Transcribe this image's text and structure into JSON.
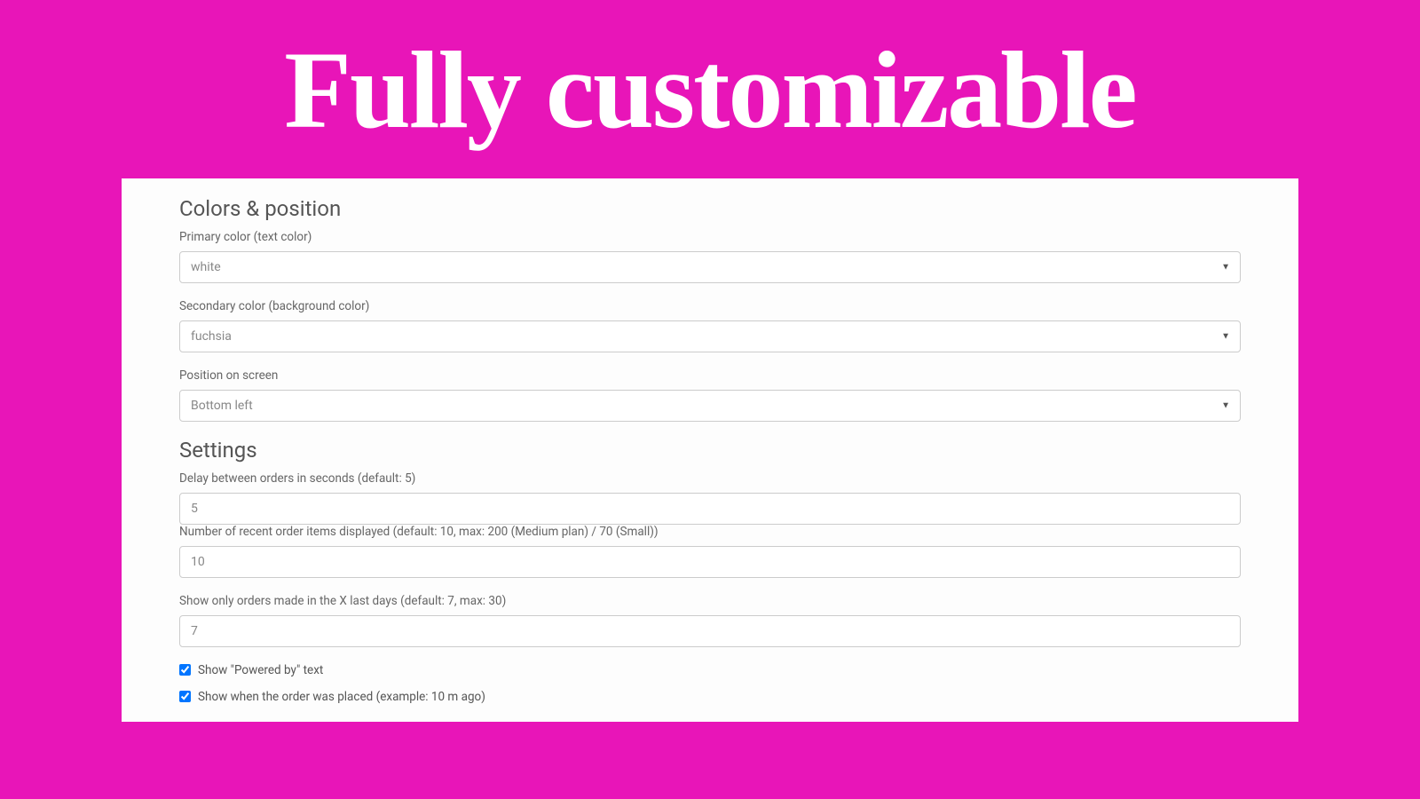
{
  "hero": {
    "title": "Fully customizable"
  },
  "section_colors": {
    "heading": "Colors & position",
    "primary_label": "Primary color (text color)",
    "primary_value": "white",
    "secondary_label": "Secondary color (background color)",
    "secondary_value": "fuchsia",
    "position_label": "Position on screen",
    "position_value": "Bottom left"
  },
  "section_settings": {
    "heading": "Settings",
    "delay_label": "Delay between orders in seconds (default: 5)",
    "delay_value": "5",
    "items_label": "Number of recent order items displayed (default: 10, max: 200 (Medium plan) / 70 (Small))",
    "items_value": "10",
    "days_label": "Show only orders made in the X last days (default: 7, max: 30)",
    "days_value": "7",
    "powered_label": "Show \"Powered by\" text",
    "time_label": "Show when the order was placed (example: 10 m ago)"
  }
}
